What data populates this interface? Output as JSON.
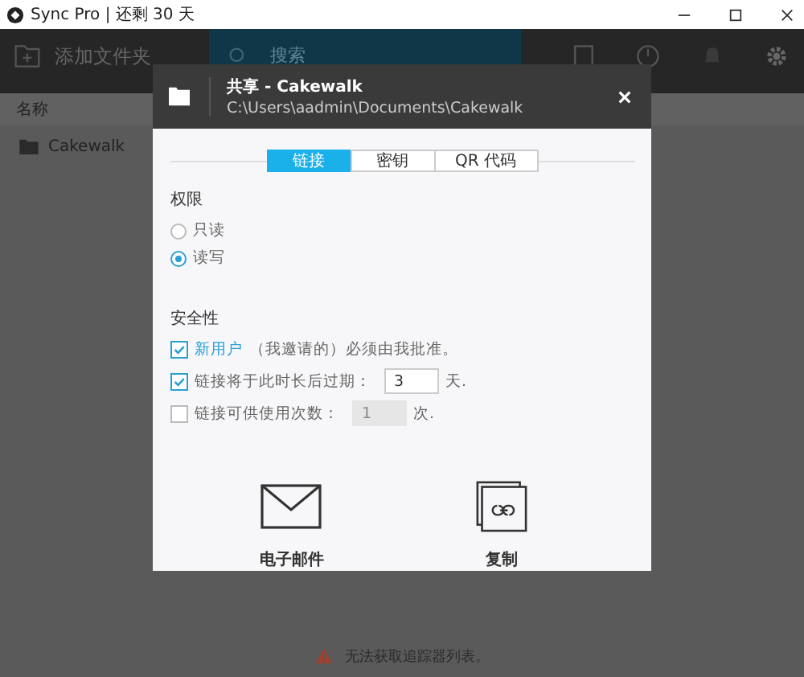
{
  "window": {
    "title": "Sync Pro | 还剩 30 天"
  },
  "toolbar": {
    "add_folder": "添加文件夹",
    "search": {
      "placeholder": "搜索"
    }
  },
  "list": {
    "columns": [
      "名称"
    ],
    "items": [
      {
        "name": "Cakewalk"
      }
    ]
  },
  "dialog": {
    "title": "共享 - Cakewalk",
    "path": "C:\\Users\\aadmin\\Documents\\Cakewalk",
    "tabs": [
      {
        "label": "链接",
        "selected": true
      },
      {
        "label": "密钥",
        "selected": false
      },
      {
        "label": "QR 代码",
        "selected": false
      }
    ],
    "permissions": {
      "heading": "权限",
      "options": [
        {
          "label": "只读",
          "selected": false
        },
        {
          "label": "读写",
          "selected": true
        }
      ]
    },
    "security": {
      "heading": "安全性",
      "options": [
        {
          "kind": "note",
          "checked": true,
          "label": "新用户",
          "note": "（我邀请的）必须由我批准。"
        },
        {
          "kind": "input",
          "checked": true,
          "label": "链接将于此时长后过期：",
          "value": "3",
          "unit": "天."
        },
        {
          "kind": "input",
          "checked": false,
          "label": "链接可供使用次数：",
          "value": "1",
          "unit": "次."
        }
      ]
    },
    "actions": [
      {
        "kind": "email",
        "label": "电子邮件"
      },
      {
        "kind": "copy",
        "label": "复制"
      }
    ]
  },
  "status": {
    "message": "无法获取追踪器列表。"
  }
}
